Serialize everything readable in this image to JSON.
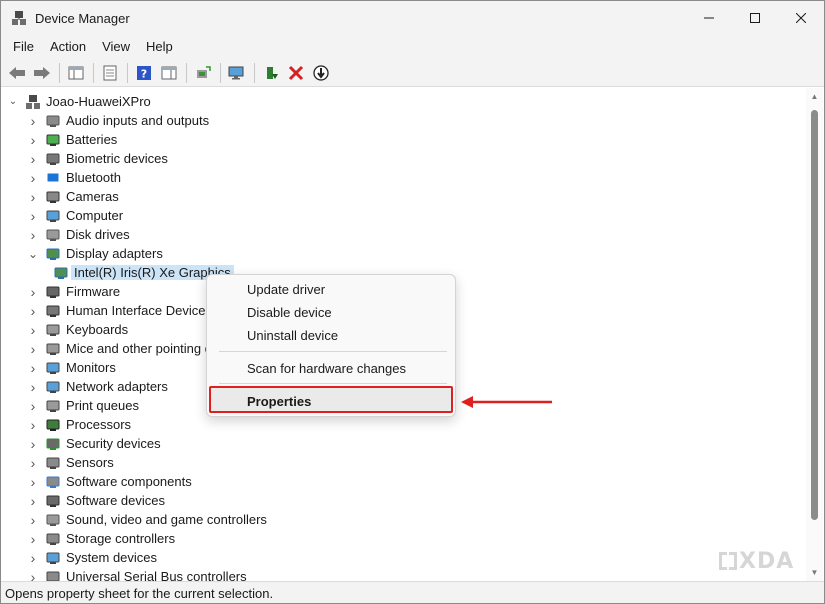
{
  "window": {
    "title": "Device Manager"
  },
  "menu": {
    "items": [
      "File",
      "Action",
      "View",
      "Help"
    ]
  },
  "toolbar": {
    "buttons": [
      "back-icon",
      "forward-icon",
      "show-hide-tree-icon",
      "properties-sheet-icon",
      "help-icon",
      "action-pane-icon",
      "update-driver-icon",
      "scan-hardware-icon",
      "enable-device-icon",
      "uninstall-device-icon",
      "disable-device-icon"
    ]
  },
  "tree": {
    "root": "Joao-HuaweiXPro",
    "categories": [
      {
        "label": "Audio inputs and outputs",
        "icon": "speaker-icon",
        "expanded": false
      },
      {
        "label": "Batteries",
        "icon": "battery-icon",
        "expanded": false
      },
      {
        "label": "Biometric devices",
        "icon": "fingerprint-icon",
        "expanded": false
      },
      {
        "label": "Bluetooth",
        "icon": "bluetooth-icon",
        "expanded": false
      },
      {
        "label": "Cameras",
        "icon": "camera-icon",
        "expanded": false
      },
      {
        "label": "Computer",
        "icon": "computer-icon",
        "expanded": false
      },
      {
        "label": "Disk drives",
        "icon": "disk-icon",
        "expanded": false
      },
      {
        "label": "Display adapters",
        "icon": "display-adapter-icon",
        "expanded": true
      },
      {
        "label": "Intel(R) Iris(R) Xe Graphics",
        "icon": "display-adapter-icon",
        "child": true,
        "selected": true
      },
      {
        "label": "Firmware",
        "icon": "firmware-icon",
        "expanded": false
      },
      {
        "label": "Human Interface Devices",
        "icon": "hid-icon",
        "expanded": false
      },
      {
        "label": "Keyboards",
        "icon": "keyboard-icon",
        "expanded": false
      },
      {
        "label": "Mice and other pointing devices",
        "icon": "mouse-icon",
        "expanded": false
      },
      {
        "label": "Monitors",
        "icon": "monitor-icon",
        "expanded": false
      },
      {
        "label": "Network adapters",
        "icon": "network-icon",
        "expanded": false
      },
      {
        "label": "Print queues",
        "icon": "printer-icon",
        "expanded": false
      },
      {
        "label": "Processors",
        "icon": "processor-icon",
        "expanded": false
      },
      {
        "label": "Security devices",
        "icon": "security-icon",
        "expanded": false
      },
      {
        "label": "Sensors",
        "icon": "sensor-icon",
        "expanded": false
      },
      {
        "label": "Software components",
        "icon": "software-component-icon",
        "expanded": false
      },
      {
        "label": "Software devices",
        "icon": "software-device-icon",
        "expanded": false
      },
      {
        "label": "Sound, video and game controllers",
        "icon": "sound-icon",
        "expanded": false
      },
      {
        "label": "Storage controllers",
        "icon": "storage-icon",
        "expanded": false
      },
      {
        "label": "System devices",
        "icon": "system-icon",
        "expanded": false
      },
      {
        "label": "Universal Serial Bus controllers",
        "icon": "usb-icon",
        "expanded": false
      }
    ]
  },
  "context_menu": {
    "update": "Update driver",
    "disable": "Disable device",
    "uninstall": "Uninstall device",
    "scan": "Scan for hardware changes",
    "properties": "Properties"
  },
  "status": {
    "text": "Opens property sheet for the current selection."
  },
  "watermark": {
    "text": "XDA"
  },
  "colors": {
    "accent_red": "#e01f1f",
    "selection": "#cce4f7",
    "chrome": "#f3f3f3"
  }
}
